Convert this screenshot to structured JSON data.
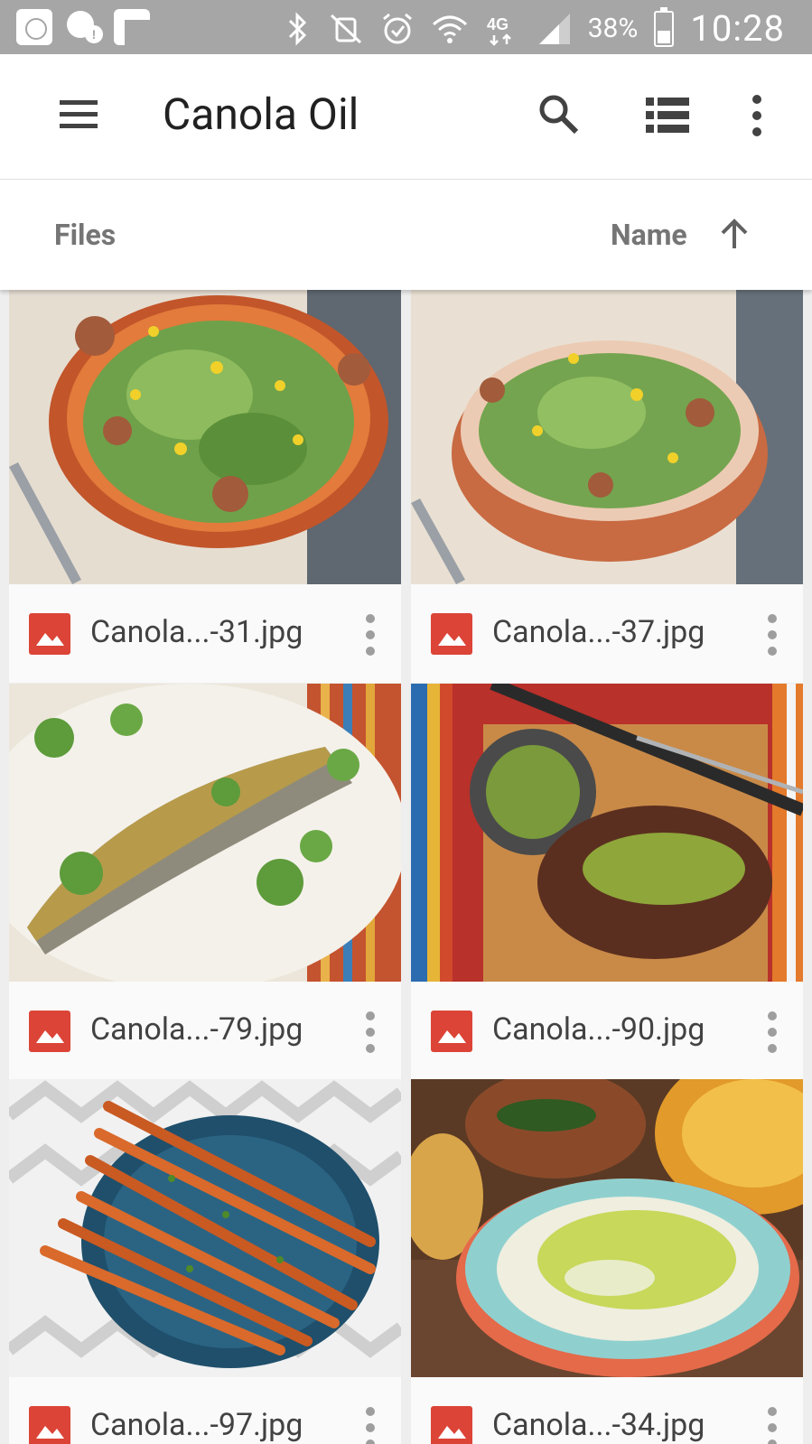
{
  "status_bar": {
    "battery": "38%",
    "time": "10:28",
    "network": "4G"
  },
  "toolbar": {
    "title": "Canola Oil",
    "icons": [
      "menu-icon",
      "search-icon",
      "list-view-icon",
      "more-vert-icon"
    ]
  },
  "sort_header": {
    "section_label": "Files",
    "sort_label": "Name",
    "sort_direction": "ascending"
  },
  "files": [
    {
      "name": "Canola...-31.jpg",
      "type": "image"
    },
    {
      "name": "Canola...-37.jpg",
      "type": "image"
    },
    {
      "name": "Canola...-79.jpg",
      "type": "image"
    },
    {
      "name": "Canola...-90.jpg",
      "type": "image"
    },
    {
      "name": "Canola...-97.jpg",
      "type": "image"
    },
    {
      "name": "Canola...-34.jpg",
      "type": "image"
    }
  ],
  "colors": {
    "status_bar": "#a6a6a6",
    "toolbar_bg": "#ffffff",
    "image_icon": "#db4437",
    "text_primary": "#212121",
    "text_secondary": "#757575"
  }
}
